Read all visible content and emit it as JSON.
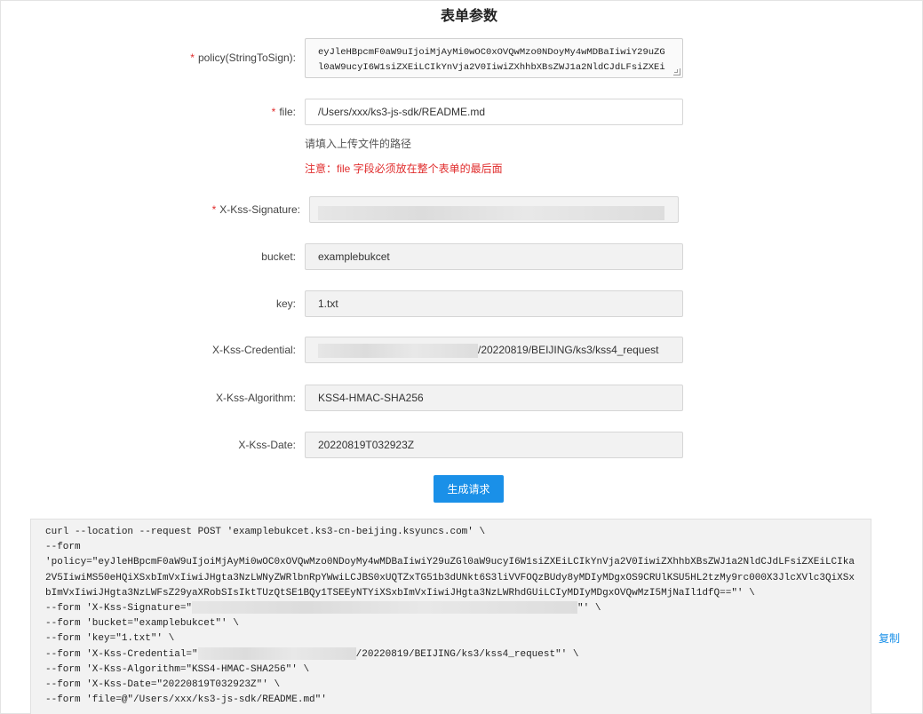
{
  "page_title": "表单参数",
  "required_mark": "*",
  "fields": {
    "policy": {
      "label": "policy(StringToSign):",
      "value": "eyJleHBpcmF0aW9uIjoiMjAyMi0wOC0xOVQwMzo0NDoyMy4wMDBaIiwiY29uZGl0aW9ucyI6W1siZXEiLCIkYnVja2V0IiwiZXhhbXBsZWJ1a2NldCJdLFsiZXEiLCIka2V5IiwiMS50eHQiXSxbImVxIiwiJHgta3NzLWNyZWRlbnRpYWwiLCJBS0xUQTZxTG51b3dUNkt6S3liVVFOQzBUdy8yMDIyMDgxOS9CRUlKSU5HL2tzMy9rc000X3JlcXVlc3QiXSxbImVxIiwiJHgta3NzLWFsZ29yaXRobSIsIktTUzQtSE1BQy1TSEEyNTYiXSxbImVxIiwiJHgta3NzLWRhdGUiLCIyMDIyMDgxOVQwMzI5MjNaIl1dfQ=="
    },
    "file": {
      "label": "file:",
      "value": "/Users/xxx/ks3-js-sdk/README.md",
      "hint": "请填入上传文件的路径",
      "warning": "注意：file 字段必须放在整个表单的最后面"
    },
    "signature": {
      "label": "X-Kss-Signature:",
      "value": ""
    },
    "bucket": {
      "label": "bucket:",
      "value": "examplebukcet"
    },
    "key": {
      "label": "key:",
      "value": "1.txt"
    },
    "credential": {
      "label": "X-Kss-Credential:",
      "value_suffix": "/20220819/BEIJING/ks3/kss4_request"
    },
    "algorithm": {
      "label": "X-Kss-Algorithm:",
      "value": "KSS4-HMAC-SHA256"
    },
    "date": {
      "label": "X-Kss-Date:",
      "value": "20220819T032923Z"
    }
  },
  "generate_button": "生成请求",
  "copy_label": "复制",
  "code": {
    "line1": "curl --location --request POST 'examplebukcet.ks3-cn-beijing.ksyuncs.com' \\",
    "line2": "--form",
    "line3": "'policy=\"eyJleHBpcmF0aW9uIjoiMjAyMi0wOC0xOVQwMzo0NDoyMy4wMDBaIiwiY29uZGl0aW9ucyI6W1siZXEiLCIkYnVja2V0IiwiZXhhbXBsZWJ1a2NldCJdLFsiZXEiLCIka2V5IiwiMS50eHQiXSxbImVxIiwiJHgta3NzLWNyZWRlbnRpYWwiLCJBS0xUQTZxTG51b3dUNkt6S3liVVFOQzBUdy8yMDIyMDgxOS9CRUlKSU5HL2tzMy9rc000X3JlcXVlc3QiXSxbImVxIiwiJHgta3NzLWFsZ29yaXRobSIsIktTUzQtSE1BQy1TSEEyNTYiXSxbImVxIiwiJHgta3NzLWRhdGUiLCIyMDIyMDgxOVQwMzI5MjNaIl1dfQ==\"' \\",
    "sig_prefix": "--form 'X-Kss-Signature=\"",
    "sig_suffix": "\"' \\",
    "bucket_line": "--form 'bucket=\"examplebukcet\"' \\",
    "key_line": "--form 'key=\"1.txt\"' \\",
    "cred_prefix": "--form 'X-Kss-Credential=\"",
    "cred_suffix": "/20220819/BEIJING/ks3/kss4_request\"' \\",
    "alg_line": "--form 'X-Kss-Algorithm=\"KSS4-HMAC-SHA256\"' \\",
    "date_line": "--form 'X-Kss-Date=\"20220819T032923Z\"' \\",
    "file_line": "--form 'file=@\"/Users/xxx/ks3-js-sdk/README.md\"'"
  }
}
